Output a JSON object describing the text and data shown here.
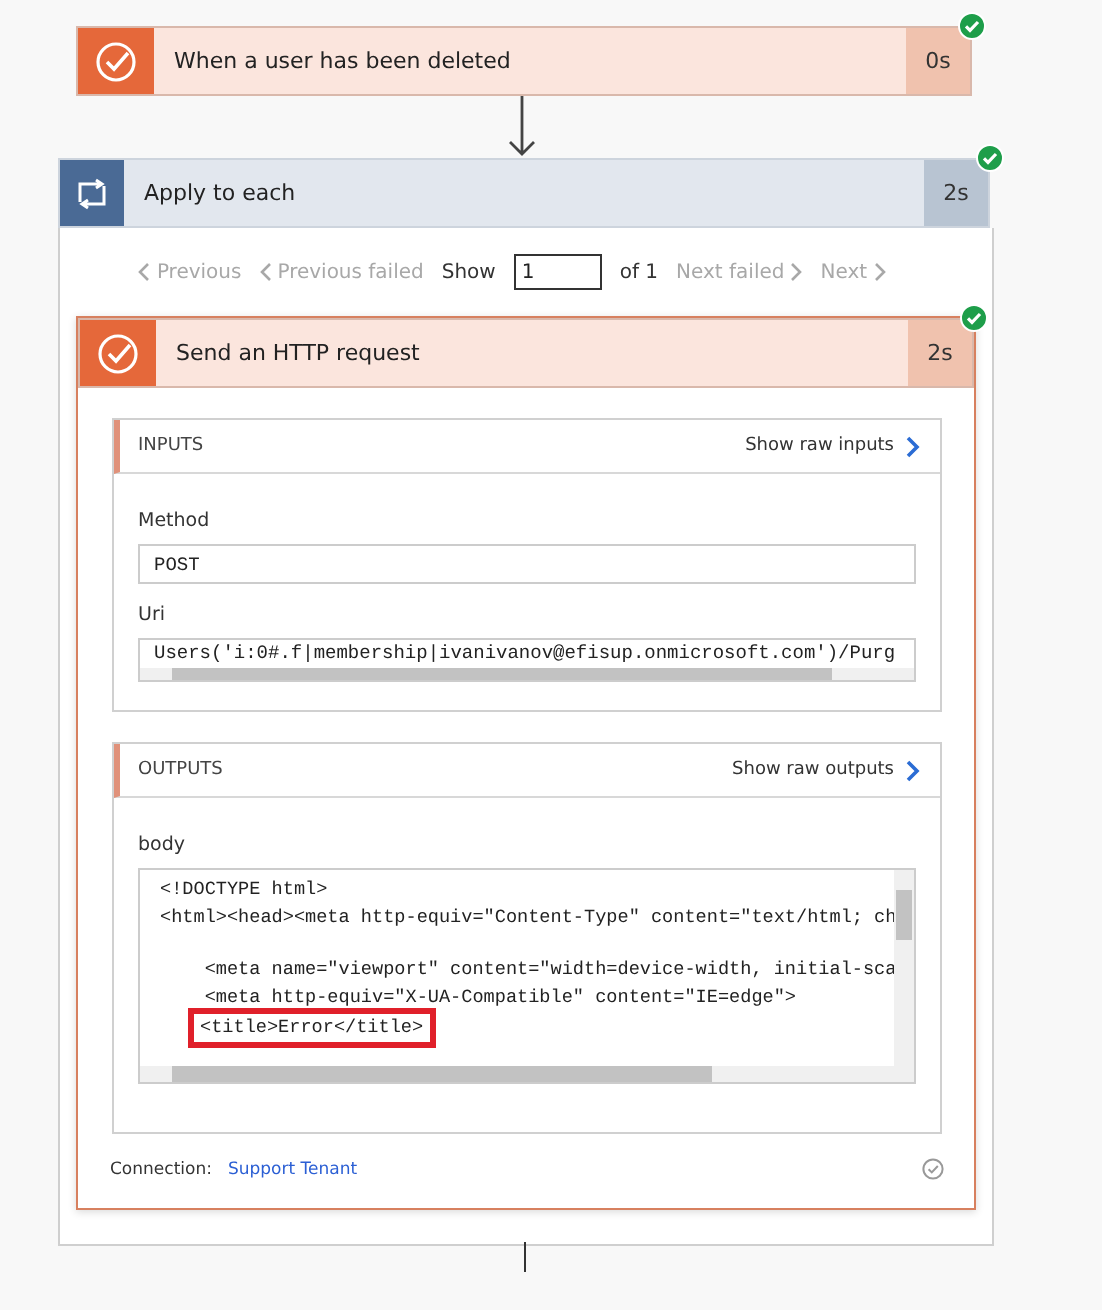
{
  "trigger": {
    "title": "When a user has been deleted",
    "duration": "0s",
    "succeeded": true
  },
  "loop": {
    "title": "Apply to each",
    "duration": "2s",
    "succeeded": true,
    "pager": {
      "previous": {
        "label": "Previous",
        "disabled": true
      },
      "previous_failed": {
        "label": "Previous failed",
        "disabled": true
      },
      "show_label": "Show",
      "show_value": "1",
      "of_label": "of 1",
      "next_failed": {
        "label": "Next failed",
        "disabled": true
      },
      "next": {
        "label": "Next",
        "disabled": true
      }
    },
    "action": {
      "title": "Send an HTTP request",
      "duration": "2s",
      "succeeded": true,
      "inputs": {
        "heading": "INPUTS",
        "raw_link": "Show raw inputs",
        "fields": [
          {
            "label": "Method",
            "kind": "text",
            "value": "POST"
          },
          {
            "label": "Uri",
            "kind": "scroll",
            "value": "Users('i:0#.f|membership|ivanivanov@efisup.onmicrosoft.com')/Purg"
          }
        ]
      },
      "outputs": {
        "heading": "OUTPUTS",
        "raw_link": "Show raw outputs",
        "field_label": "body",
        "blocks": [
          {
            "lines": [
              {
                "text": "<!DOCTYPE html>",
                "highlighted": false
              },
              {
                "text": "<html><head><meta http-equiv=\"Content-Type\" content=\"text/html; ch",
                "highlighted": false
              }
            ]
          },
          {
            "lines": [
              {
                "text": "    <meta name=\"viewport\" content=\"width=device-width, initial-sca",
                "highlighted": false
              },
              {
                "text": "    <meta http-equiv=\"X-UA-Compatible\" content=\"IE=edge\">",
                "highlighted": false
              },
              {
                "text": "    <title>Error</title>",
                "highlighted": true
              }
            ]
          }
        ]
      },
      "connection_label": "Connection:",
      "connection_link": "Support Tenant"
    }
  }
}
